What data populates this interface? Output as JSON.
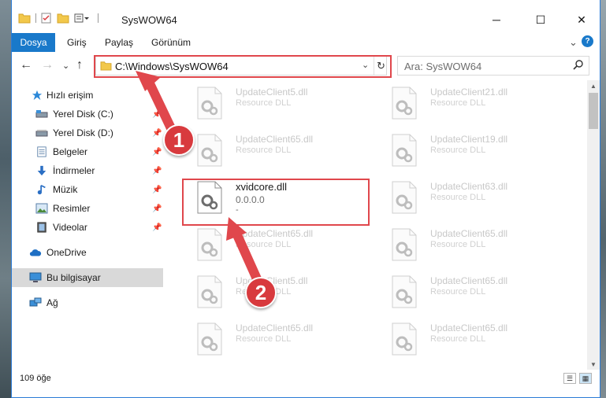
{
  "window": {
    "title": "SysWOW64",
    "minimize_glyph": "─",
    "maximize_glyph": "☐",
    "close_glyph": "✕"
  },
  "ribbon": {
    "tabs": [
      "Dosya",
      "Giriş",
      "Paylaş",
      "Görünüm"
    ],
    "expand_glyph": "⌄",
    "help_glyph": "?"
  },
  "navigation": {
    "back_glyph": "←",
    "forward_glyph": "→",
    "recent_glyph": "⌄",
    "up_glyph": "↑",
    "address": "C:\\Windows\\SysWOW64",
    "dropdown_glyph": "⌄",
    "refresh_glyph": "↻"
  },
  "search": {
    "placeholder": "Ara: SysWOW64",
    "icon": "search-icon"
  },
  "sidebar": {
    "items": [
      {
        "label": "Hızlı erişim",
        "icon": "star-icon",
        "pinned": false
      },
      {
        "label": "Yerel Disk (C:)",
        "icon": "drive-icon",
        "pinned": true
      },
      {
        "label": "Yerel Disk (D:)",
        "icon": "drive-icon",
        "pinned": true
      },
      {
        "label": "Belgeler",
        "icon": "documents-icon",
        "pinned": true
      },
      {
        "label": "İndirmeler",
        "icon": "download-icon",
        "pinned": true
      },
      {
        "label": "Müzik",
        "icon": "music-icon",
        "pinned": true
      },
      {
        "label": "Resimler",
        "icon": "pictures-icon",
        "pinned": true
      },
      {
        "label": "Videolar",
        "icon": "video-icon",
        "pinned": true
      },
      {
        "label": "OneDrive",
        "icon": "cloud-icon",
        "pinned": false
      },
      {
        "label": "Bu bilgisayar",
        "icon": "computer-icon",
        "pinned": false
      },
      {
        "label": "Ağ",
        "icon": "network-icon",
        "pinned": false
      }
    ]
  },
  "files": {
    "left": [
      {
        "name": "UpdateClient5.dll",
        "type": "Resource DLL"
      },
      {
        "name": "UpdateClient65.dll",
        "type": "Resource DLL"
      },
      {
        "name": "xvidcore.dll",
        "type": "0.0.0.0",
        "extra": "-"
      },
      {
        "name": "UpdateClient65.dll",
        "type": "Resource DLL"
      },
      {
        "name": "UpdateClient5.dll",
        "type": "Resource DLL"
      },
      {
        "name": "UpdateClient65.dll",
        "type": "Resource DLL"
      }
    ],
    "right": [
      {
        "name": "UpdateClient21.dll",
        "type": "Resource DLL"
      },
      {
        "name": "UpdateClient19.dll",
        "type": "Resource DLL"
      },
      {
        "name": "UpdateClient63.dll",
        "type": "Resource DLL"
      },
      {
        "name": "UpdateClient65.dll",
        "type": "Resource DLL"
      },
      {
        "name": "UpdateClient65.dll",
        "type": "Resource DLL"
      },
      {
        "name": "UpdateClient65.dll",
        "type": "Resource DLL"
      }
    ]
  },
  "status": {
    "item_count": "109 öğe"
  },
  "annotations": {
    "step1": "1",
    "step2": "2",
    "color": "#e0474c"
  }
}
